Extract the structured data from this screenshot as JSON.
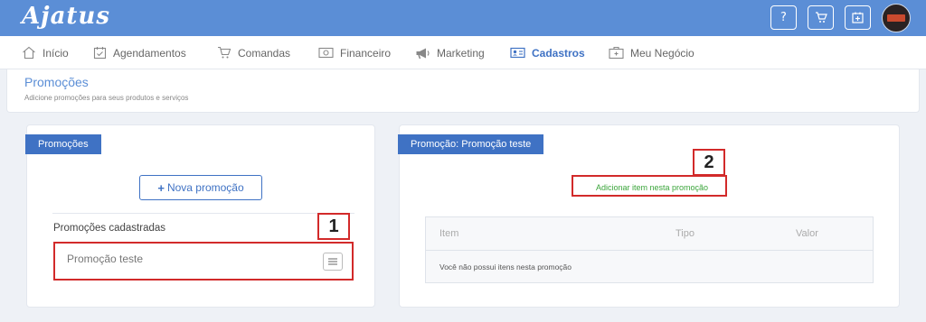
{
  "app": {
    "logo": "Ajatus"
  },
  "topbar": {
    "help_label": "?",
    "cart_icon": "cart-icon",
    "calendar_icon": "calendar-add-icon",
    "avatar_icon": "business-avatar"
  },
  "nav": {
    "items": [
      {
        "label": "Início",
        "icon": "home-icon"
      },
      {
        "label": "Agendamentos",
        "icon": "calendar-check-icon"
      },
      {
        "label": "Comandas",
        "icon": "cart-icon"
      },
      {
        "label": "Financeiro",
        "icon": "money-icon"
      },
      {
        "label": "Marketing",
        "icon": "megaphone-icon"
      },
      {
        "label": "Cadastros",
        "icon": "id-card-icon",
        "active": true
      },
      {
        "label": "Meu Negócio",
        "icon": "briefcase-icon"
      }
    ]
  },
  "page": {
    "title": "Promoções",
    "subtitle": "Adicione promoções para seus produtos e serviços"
  },
  "left_card": {
    "tab_label": "Promoções",
    "new_button": "Nova promoção",
    "list_title": "Promoções cadastradas",
    "promotions": [
      {
        "name": "Promoção teste"
      }
    ]
  },
  "right_card": {
    "tab_label": "Promoção: Promoção teste",
    "add_item_link": "Adicionar item nesta promoção",
    "table": {
      "headers": [
        "Item",
        "Tipo",
        "Valor"
      ],
      "empty_message": "Você não possui itens nesta promoção"
    }
  },
  "annotations": {
    "marker_1": "1",
    "marker_2": "2"
  },
  "colors": {
    "primary": "#3f72c4",
    "topbar": "#5b8ed6",
    "highlight": "#d22a2a",
    "success": "#3ba53b"
  }
}
